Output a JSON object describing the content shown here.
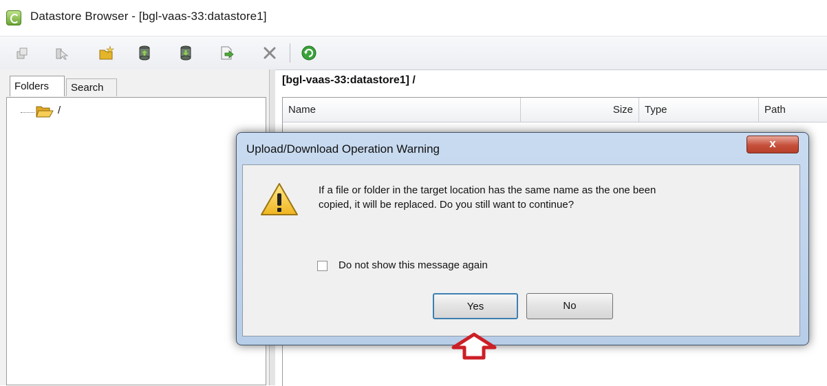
{
  "window": {
    "title": "Datastore Browser - [bgl-vaas-33:datastore1]"
  },
  "toolbar": {
    "icons": [
      "upload-icon",
      "download-icon",
      "new-folder-icon",
      "datastore-upload-icon",
      "datastore-download-icon",
      "move-icon",
      "delete-icon",
      "refresh-icon"
    ]
  },
  "left_pane": {
    "tabs": [
      {
        "label": "Folders",
        "active": true
      },
      {
        "label": "Search",
        "active": false
      }
    ],
    "tree": {
      "root_label": "/"
    }
  },
  "right_pane": {
    "path": "[bgl-vaas-33:datastore1] /",
    "columns": [
      "Name",
      "Size",
      "Type",
      "Path"
    ]
  },
  "dialog": {
    "title": "Upload/Download Operation Warning",
    "close_symbol": "x",
    "message_line1": "If a file or folder in the target location has the same name as the one been",
    "message_line2": "copied, it will be replaced. Do you still want to continue?",
    "checkbox_label": "Do not show this message again",
    "checkbox_checked": false,
    "yes_label": "Yes",
    "no_label": "No"
  },
  "annotation": {
    "color": "#cc1f26",
    "icon": "up-arrow-icon"
  }
}
